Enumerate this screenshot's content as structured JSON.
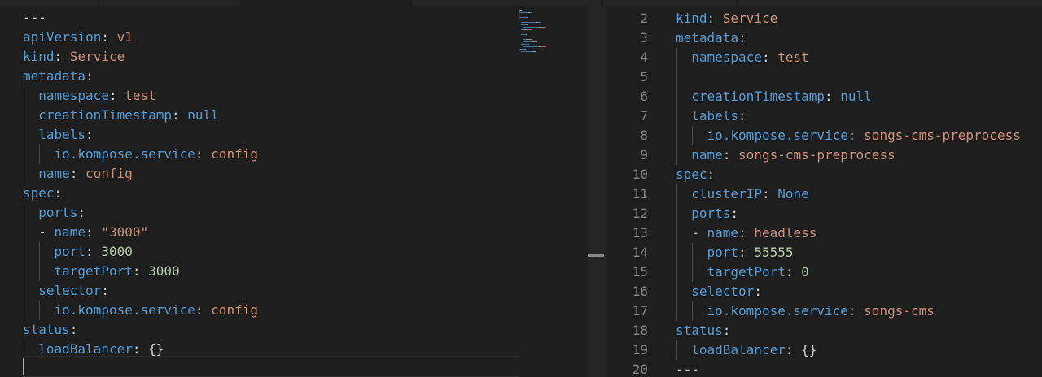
{
  "left_editor": {
    "lines": [
      {
        "indent": 0,
        "tokens": [
          {
            "t": "---",
            "c": "p"
          }
        ]
      },
      {
        "indent": 0,
        "tokens": [
          {
            "t": "apiVersion",
            "c": "k"
          },
          {
            "t": ": ",
            "c": "p"
          },
          {
            "t": "v1",
            "c": "s"
          }
        ]
      },
      {
        "indent": 0,
        "tokens": [
          {
            "t": "kind",
            "c": "k"
          },
          {
            "t": ": ",
            "c": "p"
          },
          {
            "t": "Service",
            "c": "s"
          }
        ]
      },
      {
        "indent": 0,
        "tokens": [
          {
            "t": "metadata",
            "c": "k"
          },
          {
            "t": ":",
            "c": "p"
          }
        ]
      },
      {
        "indent": 1,
        "tokens": [
          {
            "t": "namespace",
            "c": "k"
          },
          {
            "t": ": ",
            "c": "p"
          },
          {
            "t": "test",
            "c": "s"
          }
        ]
      },
      {
        "indent": 1,
        "tokens": [
          {
            "t": "creationTimestamp",
            "c": "k"
          },
          {
            "t": ": ",
            "c": "p"
          },
          {
            "t": "null",
            "c": "k"
          }
        ]
      },
      {
        "indent": 1,
        "tokens": [
          {
            "t": "labels",
            "c": "k"
          },
          {
            "t": ":",
            "c": "p"
          }
        ]
      },
      {
        "indent": 2,
        "tokens": [
          {
            "t": "io.kompose.service",
            "c": "k"
          },
          {
            "t": ": ",
            "c": "p"
          },
          {
            "t": "config",
            "c": "s"
          }
        ]
      },
      {
        "indent": 1,
        "tokens": [
          {
            "t": "name",
            "c": "k"
          },
          {
            "t": ": ",
            "c": "p"
          },
          {
            "t": "config",
            "c": "s"
          }
        ]
      },
      {
        "indent": 0,
        "tokens": [
          {
            "t": "spec",
            "c": "k"
          },
          {
            "t": ":",
            "c": "p"
          }
        ]
      },
      {
        "indent": 1,
        "tokens": [
          {
            "t": "ports",
            "c": "k"
          },
          {
            "t": ":",
            "c": "p"
          }
        ]
      },
      {
        "indent": 1,
        "tokens": [
          {
            "t": "- ",
            "c": "p"
          },
          {
            "t": "name",
            "c": "k"
          },
          {
            "t": ": ",
            "c": "p"
          },
          {
            "t": "\"3000\"",
            "c": "s"
          }
        ]
      },
      {
        "indent": 2,
        "tokens": [
          {
            "t": "port",
            "c": "k"
          },
          {
            "t": ": ",
            "c": "p"
          },
          {
            "t": "3000",
            "c": "n"
          }
        ]
      },
      {
        "indent": 2,
        "tokens": [
          {
            "t": "targetPort",
            "c": "k"
          },
          {
            "t": ": ",
            "c": "p"
          },
          {
            "t": "3000",
            "c": "n"
          }
        ]
      },
      {
        "indent": 1,
        "tokens": [
          {
            "t": "selector",
            "c": "k"
          },
          {
            "t": ":",
            "c": "p"
          }
        ]
      },
      {
        "indent": 2,
        "tokens": [
          {
            "t": "io.kompose.service",
            "c": "k"
          },
          {
            "t": ": ",
            "c": "p"
          },
          {
            "t": "config",
            "c": "s"
          }
        ]
      },
      {
        "indent": 0,
        "tokens": [
          {
            "t": "status",
            "c": "k"
          },
          {
            "t": ":",
            "c": "p"
          }
        ]
      },
      {
        "indent": 1,
        "tokens": [
          {
            "t": "loadBalancer",
            "c": "k"
          },
          {
            "t": ": ",
            "c": "p"
          },
          {
            "t": "{}",
            "c": "p"
          }
        ]
      },
      {
        "indent": 0,
        "tokens": []
      }
    ]
  },
  "right_editor": {
    "lines": [
      {
        "ln": "2",
        "indent": 0,
        "tokens": [
          {
            "t": "kind",
            "c": "k"
          },
          {
            "t": ": ",
            "c": "p"
          },
          {
            "t": "Service",
            "c": "s"
          }
        ]
      },
      {
        "ln": "3",
        "indent": 0,
        "tokens": [
          {
            "t": "metadata",
            "c": "k"
          },
          {
            "t": ":",
            "c": "p"
          }
        ]
      },
      {
        "ln": "4",
        "indent": 1,
        "tokens": [
          {
            "t": "namespace",
            "c": "k"
          },
          {
            "t": ": ",
            "c": "p"
          },
          {
            "t": "test",
            "c": "s"
          }
        ]
      },
      {
        "ln": "5",
        "indent": 1,
        "tokens": []
      },
      {
        "ln": "6",
        "indent": 1,
        "tokens": [
          {
            "t": "creationTimestamp",
            "c": "k"
          },
          {
            "t": ": ",
            "c": "p"
          },
          {
            "t": "null",
            "c": "k"
          }
        ]
      },
      {
        "ln": "7",
        "indent": 1,
        "tokens": [
          {
            "t": "labels",
            "c": "k"
          },
          {
            "t": ":",
            "c": "p"
          }
        ]
      },
      {
        "ln": "8",
        "indent": 2,
        "tokens": [
          {
            "t": "io.kompose.service",
            "c": "k"
          },
          {
            "t": ": ",
            "c": "p"
          },
          {
            "t": "songs-cms-preprocess",
            "c": "s"
          }
        ]
      },
      {
        "ln": "9",
        "indent": 1,
        "tokens": [
          {
            "t": "name",
            "c": "k"
          },
          {
            "t": ": ",
            "c": "p"
          },
          {
            "t": "songs-cms-preprocess",
            "c": "s"
          }
        ]
      },
      {
        "ln": "10",
        "indent": 0,
        "tokens": [
          {
            "t": "spec",
            "c": "k"
          },
          {
            "t": ":",
            "c": "p"
          }
        ]
      },
      {
        "ln": "11",
        "indent": 1,
        "tokens": [
          {
            "t": "clusterIP",
            "c": "k"
          },
          {
            "t": ": ",
            "c": "p"
          },
          {
            "t": "None",
            "c": "k"
          }
        ]
      },
      {
        "ln": "12",
        "indent": 1,
        "tokens": [
          {
            "t": "ports",
            "c": "k"
          },
          {
            "t": ":",
            "c": "p"
          }
        ]
      },
      {
        "ln": "13",
        "indent": 1,
        "tokens": [
          {
            "t": "- ",
            "c": "p"
          },
          {
            "t": "name",
            "c": "k"
          },
          {
            "t": ": ",
            "c": "p"
          },
          {
            "t": "headless",
            "c": "s"
          }
        ]
      },
      {
        "ln": "14",
        "indent": 2,
        "tokens": [
          {
            "t": "port",
            "c": "k"
          },
          {
            "t": ": ",
            "c": "p"
          },
          {
            "t": "55555",
            "c": "n"
          }
        ]
      },
      {
        "ln": "15",
        "indent": 2,
        "tokens": [
          {
            "t": "targetPort",
            "c": "k"
          },
          {
            "t": ": ",
            "c": "p"
          },
          {
            "t": "0",
            "c": "n"
          }
        ]
      },
      {
        "ln": "16",
        "indent": 1,
        "tokens": [
          {
            "t": "selector",
            "c": "k"
          },
          {
            "t": ":",
            "c": "p"
          }
        ]
      },
      {
        "ln": "17",
        "indent": 2,
        "tokens": [
          {
            "t": "io.kompose.service",
            "c": "k"
          },
          {
            "t": ": ",
            "c": "p"
          },
          {
            "t": "songs-cms",
            "c": "s"
          }
        ]
      },
      {
        "ln": "18",
        "indent": 0,
        "tokens": [
          {
            "t": "status",
            "c": "k"
          },
          {
            "t": ":",
            "c": "p"
          }
        ]
      },
      {
        "ln": "19",
        "indent": 1,
        "tokens": [
          {
            "t": "loadBalancer",
            "c": "k"
          },
          {
            "t": ": ",
            "c": "p"
          },
          {
            "t": "{}",
            "c": "p"
          }
        ]
      },
      {
        "ln": "20",
        "indent": 0,
        "tokens": [
          {
            "t": "---",
            "c": "p"
          }
        ]
      }
    ]
  },
  "colors": {
    "key": "#569cd6",
    "string": "#ce9178",
    "number": "#b5cea8",
    "punctuation": "#d4d4d4",
    "line_number": "#858585",
    "background": "#1e1e1e"
  }
}
